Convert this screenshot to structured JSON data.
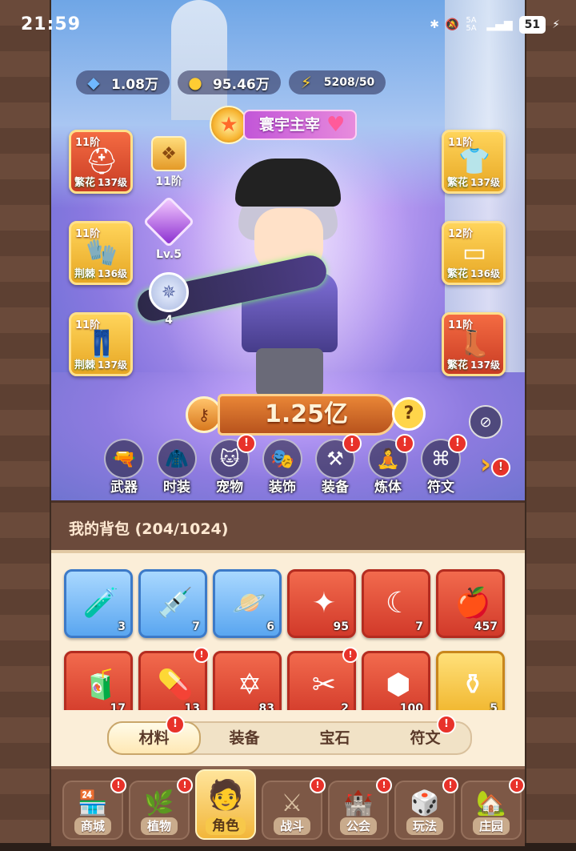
{
  "status_bar": {
    "time": "21:59",
    "network": "5A 5A",
    "battery": "51"
  },
  "currencies": [
    {
      "icon": "gem-icon",
      "value": "1.08万"
    },
    {
      "icon": "coin-icon",
      "value": "95.46万"
    },
    {
      "icon": "energy-icon",
      "value": "5208/50"
    }
  ],
  "title_badge": {
    "label": "寰宇主宰"
  },
  "pet": {
    "level": "11阶",
    "gem_level": "Lv.5",
    "wheel_level": "4"
  },
  "equipment_left": [
    {
      "tier": "11阶",
      "name": "繁花",
      "level": "137级",
      "icon": "helmet-icon"
    },
    {
      "tier": "11阶",
      "name": "荆棘",
      "level": "136级",
      "icon": "gloves-icon"
    },
    {
      "tier": "11阶",
      "name": "荆棘",
      "level": "137级",
      "icon": "pants-icon"
    }
  ],
  "equipment_right": [
    {
      "tier": "11阶",
      "name": "繁花",
      "level": "137级",
      "icon": "armor-icon"
    },
    {
      "tier": "12阶",
      "name": "繁花",
      "level": "136级",
      "icon": "belt-icon"
    },
    {
      "tier": "11阶",
      "name": "繁花",
      "level": "137级",
      "icon": "boots-icon"
    }
  ],
  "power": {
    "value": "1.25亿",
    "help": "?"
  },
  "categories": [
    {
      "label": "武器",
      "icon": "weapon-icon",
      "badge": ""
    },
    {
      "label": "时装",
      "icon": "outfit-icon",
      "badge": ""
    },
    {
      "label": "宠物",
      "icon": "pet-icon",
      "badge": "!"
    },
    {
      "label": "装饰",
      "icon": "mask-icon",
      "badge": ""
    },
    {
      "label": "装备",
      "icon": "equipment-icon",
      "badge": "!"
    },
    {
      "label": "炼体",
      "icon": "body-icon",
      "badge": "!"
    },
    {
      "label": "符文",
      "icon": "rune-icon",
      "badge": "!"
    }
  ],
  "bag": {
    "title": "我的背包 (204/1024)",
    "items": [
      {
        "icon": "potion-bottle-icon",
        "count": "3",
        "rarity": "blue",
        "badge": ""
      },
      {
        "icon": "syringe-icon",
        "count": "7",
        "rarity": "blue",
        "badge": ""
      },
      {
        "icon": "astrolabe-icon",
        "count": "6",
        "rarity": "blue",
        "badge": ""
      },
      {
        "icon": "star-crystal-icon",
        "count": "95",
        "rarity": "red",
        "badge": ""
      },
      {
        "icon": "moon-crystal-icon",
        "count": "7",
        "rarity": "red",
        "badge": ""
      },
      {
        "icon": "red-fruit-icon",
        "count": "457",
        "rarity": "red",
        "badge": ""
      },
      {
        "icon": "green-canister-icon",
        "count": "17",
        "rarity": "red",
        "badge": ""
      },
      {
        "icon": "green-pill-icon",
        "count": "13",
        "rarity": "red",
        "badge": "!"
      },
      {
        "icon": "hexagram-icon",
        "count": "83",
        "rarity": "red",
        "badge": ""
      },
      {
        "icon": "scissors-icon",
        "count": "2",
        "rarity": "red",
        "badge": "!"
      },
      {
        "icon": "cube-crystal-icon",
        "count": "100",
        "rarity": "red",
        "badge": ""
      },
      {
        "icon": "golden-flask-icon",
        "count": "5",
        "rarity": "gold",
        "badge": ""
      }
    ],
    "tabs": [
      {
        "label": "材料",
        "active": true,
        "badge": "!"
      },
      {
        "label": "装备",
        "active": false,
        "badge": ""
      },
      {
        "label": "宝石",
        "active": false,
        "badge": ""
      },
      {
        "label": "符文",
        "active": false,
        "badge": "!"
      }
    ]
  },
  "bottom_nav": [
    {
      "label": "商城",
      "icon": "shop-icon",
      "badge": "!",
      "active": false
    },
    {
      "label": "植物",
      "icon": "plant-icon",
      "badge": "!",
      "active": false
    },
    {
      "label": "角色",
      "icon": "character-icon",
      "badge": "",
      "active": true
    },
    {
      "label": "战斗",
      "icon": "battle-icon",
      "badge": "!",
      "active": false
    },
    {
      "label": "公会",
      "icon": "guild-icon",
      "badge": "!",
      "active": false
    },
    {
      "label": "玩法",
      "icon": "gameplay-icon",
      "badge": "!",
      "active": false
    },
    {
      "label": "庄园",
      "icon": "manor-icon",
      "badge": "!",
      "active": false
    }
  ]
}
